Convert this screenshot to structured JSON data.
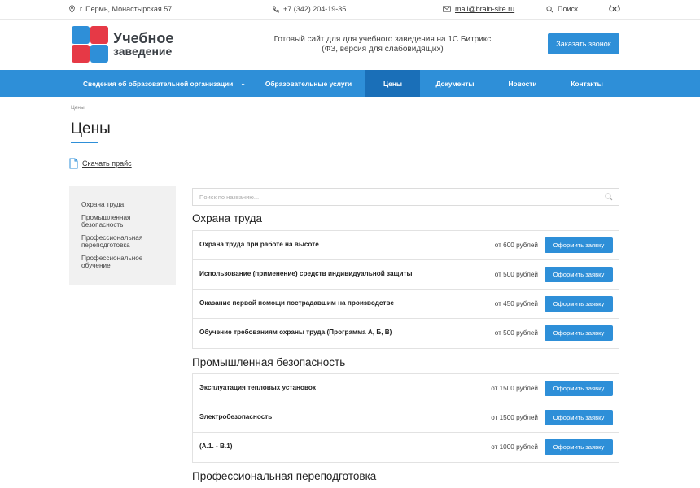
{
  "topbar": {
    "address": "г. Пермь, Монастырская 57",
    "phone": "+7 (342) 204-19-35",
    "email": "mail@brain-site.ru",
    "search_label": "Поиск"
  },
  "header": {
    "logo_line1": "Учебное",
    "logo_line2": "заведение",
    "tagline_line1": "Готовый сайт для для учебного заведения на 1С Битрикс",
    "tagline_line2": "(ФЗ, версия для слабовидящих)",
    "call_button": "Заказать звонок"
  },
  "nav": {
    "items": [
      {
        "label": "Сведения об образовательной организации"
      },
      {
        "label": "Образовательные услуги"
      },
      {
        "label": "Цены"
      },
      {
        "label": "Документы"
      },
      {
        "label": "Новости"
      },
      {
        "label": "Контакты"
      }
    ],
    "active": "Цены"
  },
  "breadcrumb": "Цены",
  "page_title": "Цены",
  "download_label": "Скачать прайс",
  "sidebar": {
    "items": [
      {
        "label": "Охрана труда"
      },
      {
        "label": "Промышленная безопасность"
      },
      {
        "label": "Профессиональная переподготовка"
      },
      {
        "label": "Профессиональное обучение"
      }
    ]
  },
  "search": {
    "placeholder": "Поиск по названию..."
  },
  "sections": [
    {
      "title": "Охрана труда",
      "rows": [
        {
          "name": "Охрана труда при работе на высоте",
          "price": "от 600 рублей",
          "button": "Оформить заявку"
        },
        {
          "name": "Использование (применение) средств индивидуальной защиты",
          "price": "от 500 рублей",
          "button": "Оформить заявку"
        },
        {
          "name": "Оказание первой помощи пострадавшим на производстве",
          "price": "от 450 рублей",
          "button": "Оформить заявку"
        },
        {
          "name": "Обучение требованиям охраны труда (Программа А, Б, В)",
          "price": "от 500 рублей",
          "button": "Оформить заявку"
        }
      ]
    },
    {
      "title": "Промышленная безопасность",
      "rows": [
        {
          "name": "Эксплуатация тепловых установок",
          "price": "от 1500 рублей",
          "button": "Оформить заявку"
        },
        {
          "name": "Электробезопасность",
          "price": "от 1500 рублей",
          "button": "Оформить заявку"
        },
        {
          "name": "(А.1. - В.1)",
          "price": "от 1000 рублей",
          "button": "Оформить заявку"
        }
      ]
    },
    {
      "title": "Профессиональная переподготовка",
      "rows": []
    }
  ],
  "colors": {
    "accent": "#2e8fd8",
    "nav_active": "#1a6fb8",
    "sidebar_bg": "#f1f1f1"
  }
}
